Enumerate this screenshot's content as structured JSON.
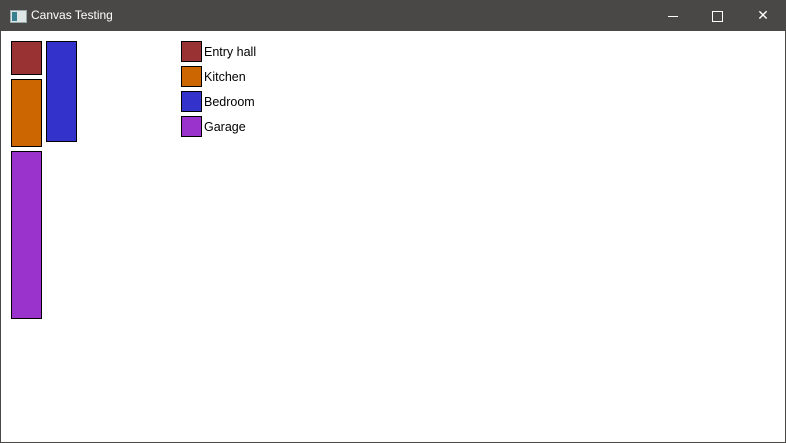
{
  "window": {
    "title": "Canvas Testing",
    "icon": "app-window-icon"
  },
  "controls": {
    "minimize": "minimize-icon",
    "maximize": "maximize-icon",
    "close": "close-icon",
    "close_glyph": "✕"
  },
  "rooms": [
    {
      "name": "Entry hall",
      "color": "#993333",
      "relative_size": 1
    },
    {
      "name": "Kitchen",
      "color": "#cc6600",
      "relative_size": 2
    },
    {
      "name": "Bedroom",
      "color": "#3333cc",
      "relative_size": 3
    },
    {
      "name": "Garage",
      "color": "#9933cc",
      "relative_size": 5
    }
  ]
}
